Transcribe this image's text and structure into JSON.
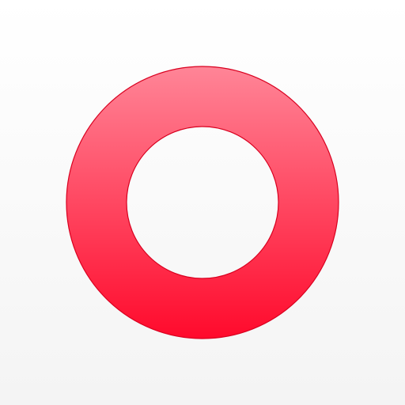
{
  "icon": {
    "name": "ring-icon",
    "shape": "ring",
    "colors": {
      "background_top": "#ffffff",
      "background_bottom": "#f4f4f4",
      "ring_top": "#ff8597",
      "ring_bottom": "#ff0a2c",
      "ring_outline": "#d9001f"
    }
  }
}
